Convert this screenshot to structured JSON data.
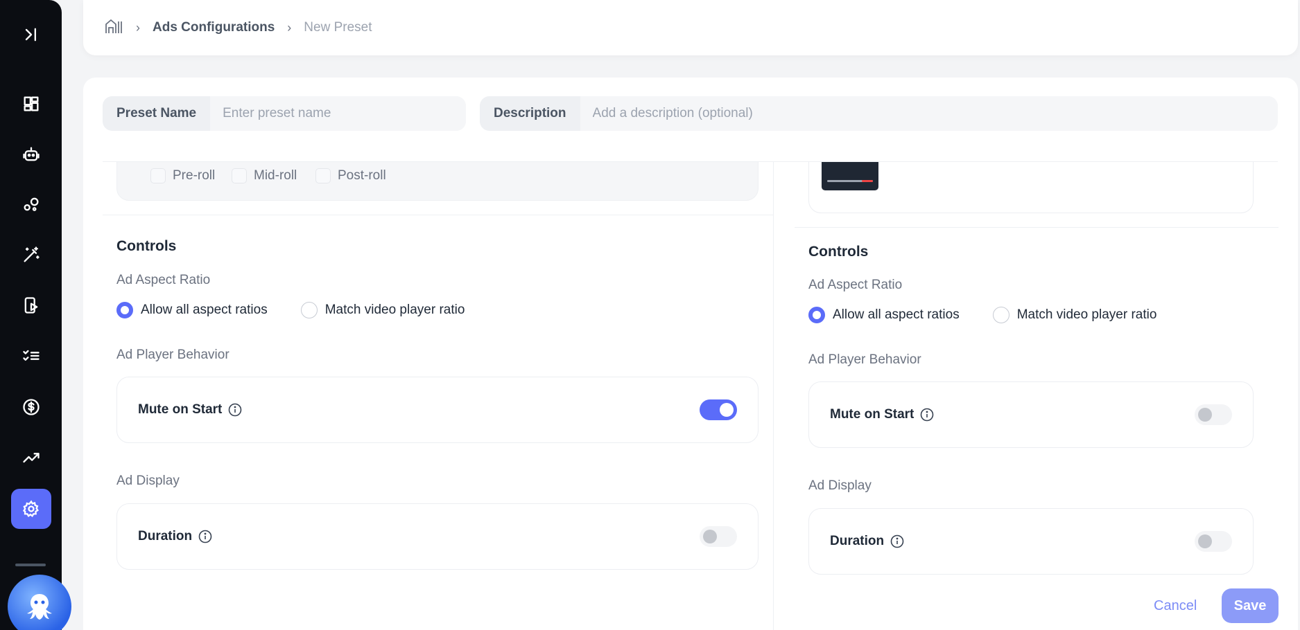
{
  "sidebar": {
    "icons": [
      "expand-icon",
      "dashboard-icon",
      "robot-icon",
      "bubbles-icon",
      "magic-wand-icon",
      "mobile-play-icon",
      "checklist-icon",
      "dollar-icon",
      "trend-icon",
      "gear-icon"
    ],
    "active": "gear-icon"
  },
  "breadcrumb": {
    "home_icon": "home-icon",
    "link": "Ads Configurations",
    "current": "New Preset"
  },
  "form": {
    "preset_name_label": "Preset Name",
    "preset_name_placeholder": "Enter preset name",
    "preset_name_value": "",
    "description_label": "Description",
    "description_placeholder": "Add a description (optional)",
    "description_value": ""
  },
  "left": {
    "rolls": [
      "Pre-roll",
      "Mid-roll",
      "Post-roll"
    ],
    "controls_title": "Controls",
    "aspect_title": "Ad Aspect Ratio",
    "aspect_options": [
      "Allow all aspect ratios",
      "Match video player ratio"
    ],
    "aspect_selected": 0,
    "behavior_title": "Ad Player Behavior",
    "mute_label": "Mute on Start",
    "mute_on": true,
    "display_title": "Ad Display",
    "duration_label": "Duration",
    "duration_on": false
  },
  "right": {
    "controls_title": "Controls",
    "aspect_title": "Ad Aspect Ratio",
    "aspect_options": [
      "Allow all aspect ratios",
      "Match video player ratio"
    ],
    "aspect_selected": 0,
    "behavior_title": "Ad Player Behavior",
    "mute_label": "Mute on Start",
    "mute_on": false,
    "display_title": "Ad Display",
    "duration_label": "Duration",
    "duration_on": false
  },
  "footer": {
    "cancel": "Cancel",
    "save": "Save"
  },
  "colors": {
    "accent": "#5b6cf9",
    "sidebar_bg": "#0b0d12"
  }
}
